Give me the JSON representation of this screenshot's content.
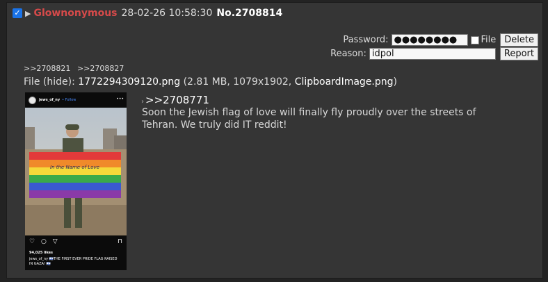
{
  "post": {
    "checkbox_mark": "✓",
    "expand_glyph": "▶",
    "name": "Glownonymous",
    "datetime": "28-02-26 10:58:30",
    "post_no": "No.2708814",
    "backlinks": [
      ">>2708821",
      ">>2708827"
    ],
    "file": {
      "prefix": "File (",
      "hide": "hide",
      "sep": "): ",
      "filename": "1772294309120.png",
      "meta_open": " (2.81 MB, 1079x1902, ",
      "original_name": "ClipboardImage.png",
      "meta_close": ")"
    },
    "quote_link": ">>2708771",
    "quote_arrow": "›",
    "message": "Soon the Jewish flag of love will finally fly proudly over the streets of Tehran. We truly did IT reddit!"
  },
  "delete_form": {
    "password_label": "Password:",
    "password_value": "●●●●●●●●",
    "file_label": "File",
    "delete_button": "Delete",
    "reason_label": "Reason:",
    "reason_value": "idpol",
    "report_button": "Report"
  },
  "thumbnail": {
    "handle": "jews_of_ny",
    "follow": "• Follow",
    "dots": "•••",
    "flag_text_line1": "In the Name of Love",
    "likes": "94,025 likes",
    "caption": "jews_of_ny 🇮🇱THE FIRST EVER PRIDE FLAG RAISED IN GAZA! 🇮🇱",
    "icons": [
      "♡",
      "○",
      "▽"
    ],
    "bookmark": "⊓"
  },
  "colors": {
    "name": "#d64a4a",
    "post_bg": "#353535",
    "page_bg": "#232323",
    "checkbox": "#1a73e8"
  }
}
